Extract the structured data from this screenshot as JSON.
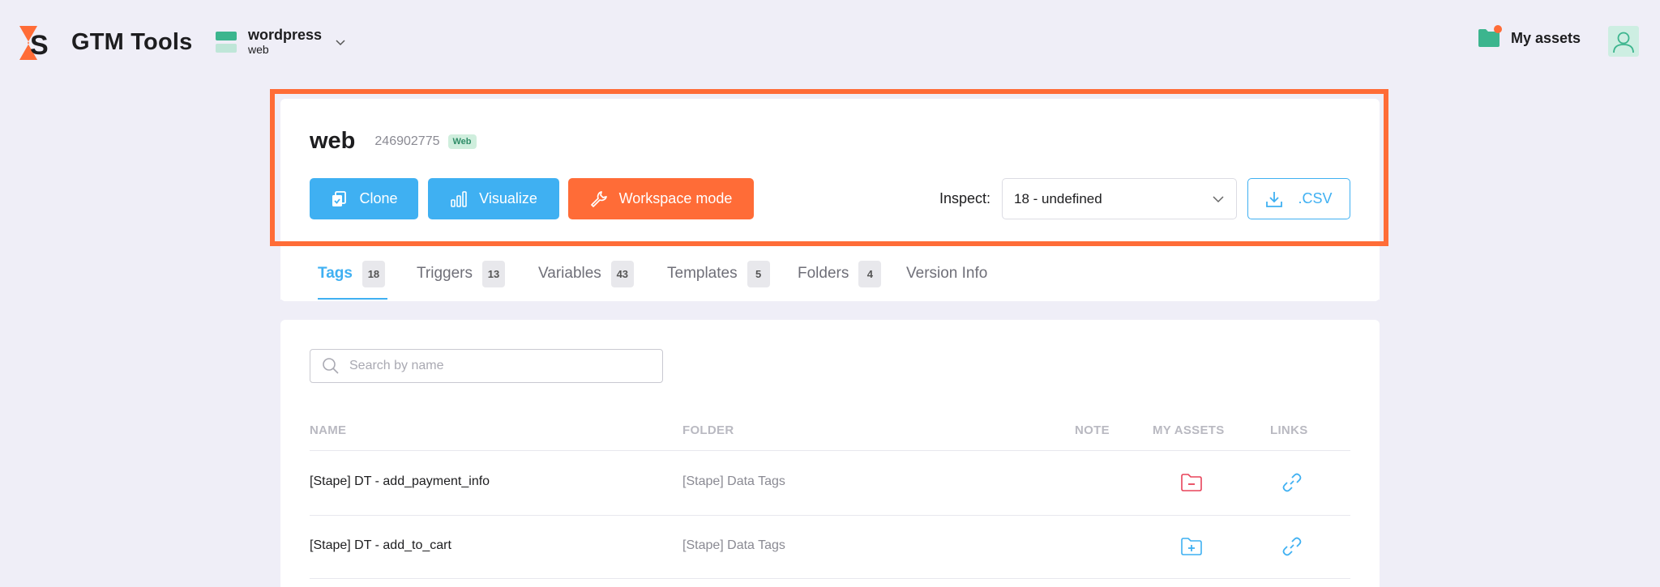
{
  "header": {
    "brand": "GTM Tools",
    "container": {
      "name": "wordpress",
      "type": "web"
    },
    "my_assets_label": "My assets"
  },
  "container_info": {
    "title": "web",
    "id": "246902775",
    "badge": "Web"
  },
  "actions": {
    "clone_label": "Clone",
    "visualize_label": "Visualize",
    "workspace_label": "Workspace mode",
    "inspect_label": "Inspect:",
    "inspect_value": "18 - undefined",
    "csv_label": ".CSV"
  },
  "tabs": [
    {
      "label": "Tags",
      "count": "18",
      "active": true
    },
    {
      "label": "Triggers",
      "count": "13"
    },
    {
      "label": "Variables",
      "count": "43"
    },
    {
      "label": "Templates",
      "count": "5"
    },
    {
      "label": "Folders",
      "count": "4"
    },
    {
      "label": "Version Info"
    }
  ],
  "search": {
    "placeholder": "Search by name"
  },
  "table": {
    "columns": [
      "NAME",
      "FOLDER",
      "NOTE",
      "MY ASSETS",
      "LINKS"
    ],
    "rows": [
      {
        "name": "[Stape] DT - add_payment_info",
        "folder": "[Stape] Data Tags",
        "asset_icon": "folder-minus-icon"
      },
      {
        "name": "[Stape] DT - add_to_cart",
        "folder": "[Stape] Data Tags",
        "asset_icon": "folder-plus-icon"
      }
    ]
  },
  "colors": {
    "accent": "#3fb0f2",
    "orange": "#ff6c37",
    "green": "#3cb58e",
    "remove": "#e8435a"
  }
}
